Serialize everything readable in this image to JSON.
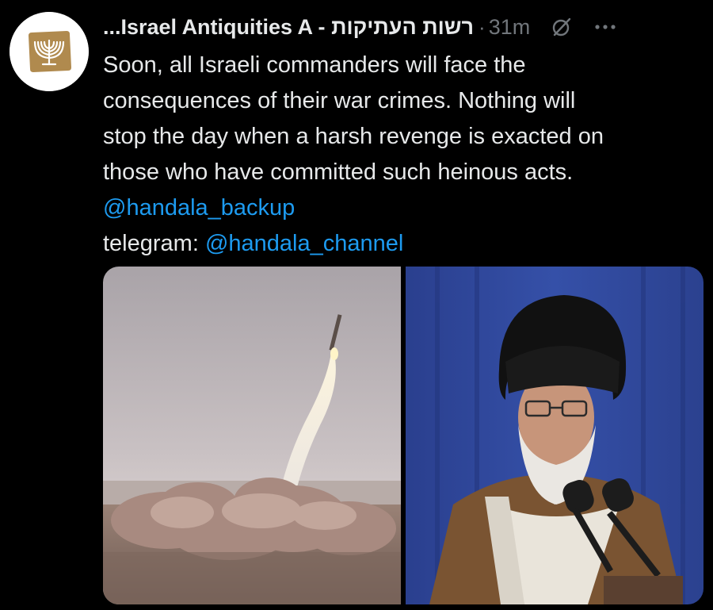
{
  "tweet": {
    "author": {
      "display_name": "...Israel Antiquities A - רשות העתיקות",
      "avatar_icon": "menorah-logo-icon"
    },
    "separator": "·",
    "timestamp": "31m",
    "body_lines": [
      "Soon, all Israeli commanders will face the",
      "consequences of their war crimes. Nothing will",
      "stop the day when a harsh revenge is exacted on",
      "those who have committed such heinous acts."
    ],
    "mention_1": "@handala_backup",
    "telegram_label": "telegram: ",
    "mention_2": "@handala_channel",
    "media": [
      {
        "kind": "photo",
        "subject": "missile-launch-photo"
      },
      {
        "kind": "photo",
        "subject": "cleric-at-microphones-photo"
      }
    ]
  },
  "colors": {
    "background": "#000000",
    "text": "#e7e9ea",
    "muted": "#71767b",
    "link": "#1d9bf0",
    "logo_gold": "#b08a4e"
  }
}
